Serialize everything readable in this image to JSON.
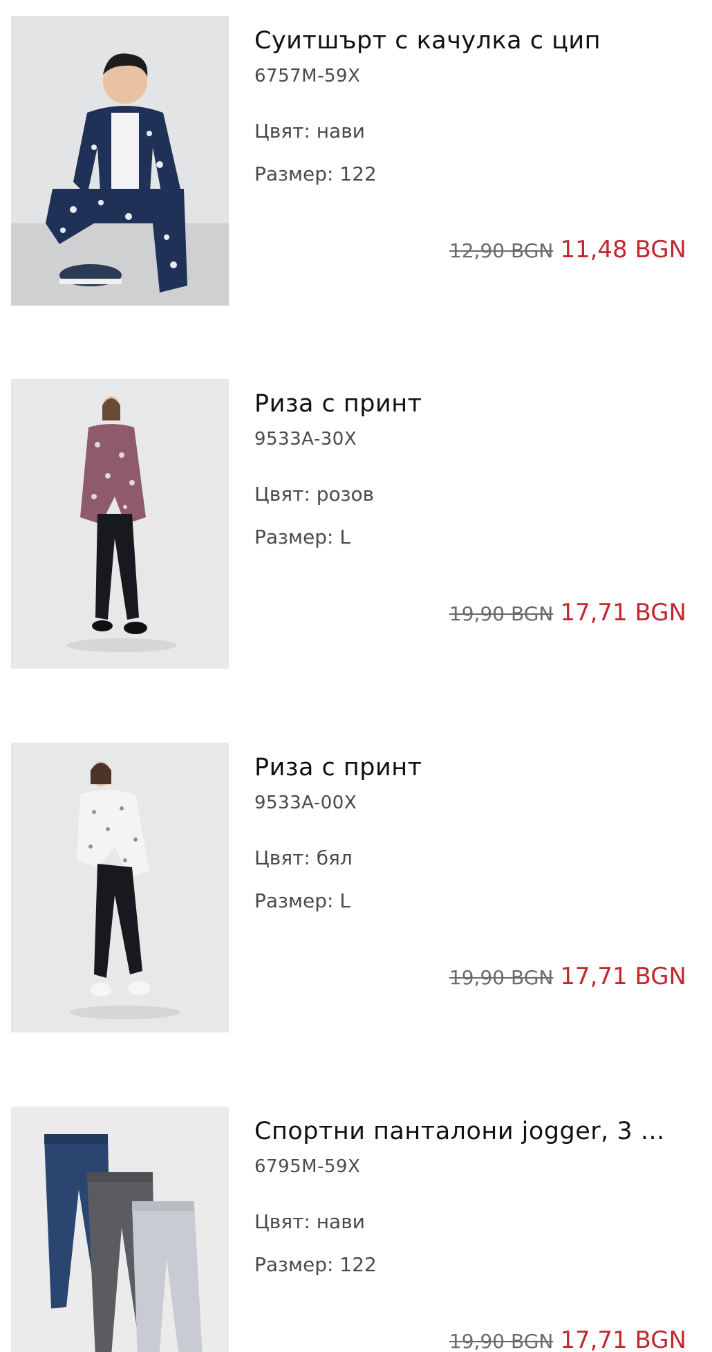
{
  "cart": {
    "items": [
      {
        "title": "Суитшърт с качулка с цип",
        "sku": "6757M-59X",
        "color_label": "Цвят: нави",
        "size_label": "Размер: 122",
        "old_price": "12,90 BGN",
        "new_price": "11,48 BGN",
        "image": "product-photo-boy-navy-hoodie"
      },
      {
        "title": "Риза с принт",
        "sku": "9533A-30X",
        "color_label": "Цвят: розов",
        "size_label": "Размер: L",
        "old_price": "19,90 BGN",
        "new_price": "17,71 BGN",
        "image": "product-photo-woman-pink-print-shirt"
      },
      {
        "title": "Риза с принт",
        "sku": "9533A-00X",
        "color_label": "Цвят: бял",
        "size_label": "Размер: L",
        "old_price": "19,90 BGN",
        "new_price": "17,71 BGN",
        "image": "product-photo-woman-white-print-shirt"
      },
      {
        "title": "Спортни панталони jogger, 3 ...",
        "sku": "6795M-59X",
        "color_label": "Цвят: нави",
        "size_label": "Размер: 122",
        "old_price": "19,90 BGN",
        "new_price": "17,71 BGN",
        "image": "product-photo-three-joggers"
      }
    ]
  },
  "colors": {
    "sale_price": "#c1272d",
    "old_price": "#6b6b6b",
    "text_secondary": "#4a4a4a"
  }
}
